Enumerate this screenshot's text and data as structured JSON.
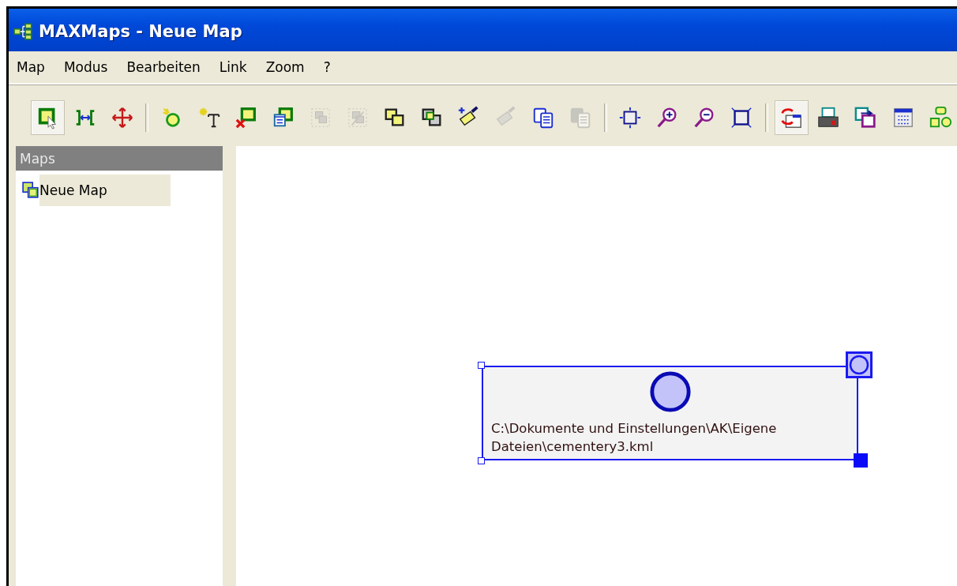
{
  "window": {
    "title": "MAXMaps - Neue Map"
  },
  "menu": [
    "Map",
    "Modus",
    "Bearbeiten",
    "Link",
    "Zoom",
    "?"
  ],
  "toolbar": [
    {
      "kind": "select",
      "pressed": true,
      "disabled": false
    },
    {
      "kind": "link",
      "pressed": false,
      "disabled": false
    },
    {
      "kind": "move",
      "pressed": false,
      "disabled": false
    },
    {
      "kind": "separator"
    },
    {
      "kind": "new-node",
      "pressed": false,
      "disabled": false
    },
    {
      "kind": "new-text",
      "pressed": false,
      "disabled": false
    },
    {
      "kind": "delete",
      "pressed": false,
      "disabled": false
    },
    {
      "kind": "properties",
      "pressed": false,
      "disabled": false
    },
    {
      "kind": "group",
      "pressed": false,
      "disabled": true
    },
    {
      "kind": "ungroup",
      "pressed": false,
      "disabled": true
    },
    {
      "kind": "front",
      "pressed": false,
      "disabled": false
    },
    {
      "kind": "back",
      "pressed": false,
      "disabled": false
    },
    {
      "kind": "format",
      "pressed": false,
      "disabled": false
    },
    {
      "kind": "format",
      "pressed": false,
      "disabled": true
    },
    {
      "kind": "copy",
      "pressed": false,
      "disabled": false
    },
    {
      "kind": "copy",
      "pressed": false,
      "disabled": true
    },
    {
      "kind": "separator"
    },
    {
      "kind": "fit",
      "pressed": false,
      "disabled": false
    },
    {
      "kind": "zoom-in",
      "pressed": false,
      "disabled": false
    },
    {
      "kind": "zoom-out",
      "pressed": false,
      "disabled": false
    },
    {
      "kind": "fullscreen",
      "pressed": false,
      "disabled": false
    },
    {
      "kind": "separator"
    },
    {
      "kind": "sync",
      "pressed": true,
      "disabled": false
    },
    {
      "kind": "print",
      "pressed": false,
      "disabled": false
    },
    {
      "kind": "export",
      "pressed": false,
      "disabled": false
    },
    {
      "kind": "table",
      "pressed": false,
      "disabled": false
    },
    {
      "kind": "shapes",
      "pressed": false,
      "disabled": false
    }
  ],
  "sidebar": {
    "header": "Maps",
    "items": [
      {
        "label": "Neue Map",
        "selected": true
      }
    ]
  },
  "canvas": {
    "nodes": [
      {
        "label": "C:\\Dokumente und Einstellungen\\AK\\Eigene Dateien\\cementery3.kml",
        "selected": true
      }
    ]
  }
}
